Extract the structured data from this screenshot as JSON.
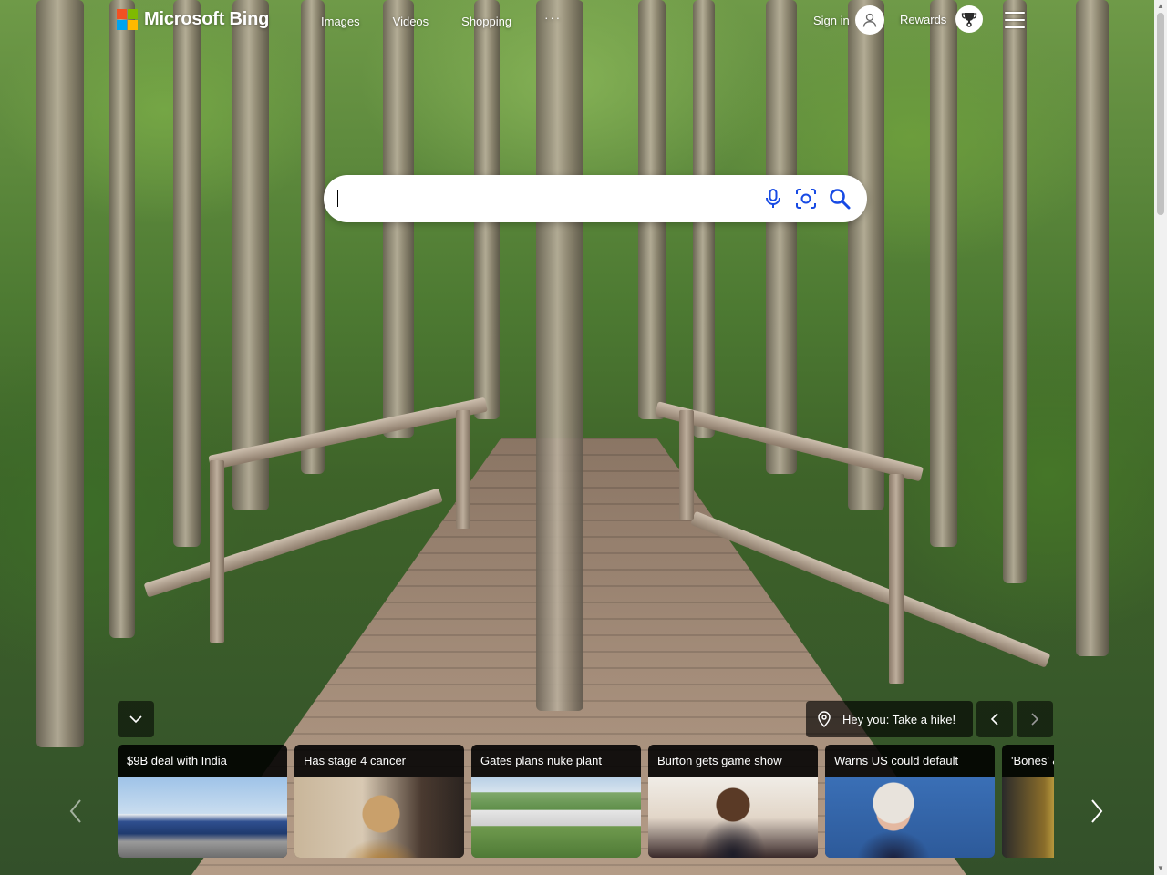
{
  "header": {
    "logo_text": "Microsoft Bing",
    "nav": [
      {
        "label": "Images"
      },
      {
        "label": "Videos"
      },
      {
        "label": "Shopping"
      }
    ],
    "more_label": "···",
    "signin_label": "Sign in",
    "rewards_label": "Rewards"
  },
  "search": {
    "value": "",
    "placeholder": ""
  },
  "background": {
    "caption": "Hey you: Take a hike!"
  },
  "news": [
    {
      "title": "$9B deal with India"
    },
    {
      "title": "Has stage 4 cancer"
    },
    {
      "title": "Gates plans nuke plant"
    },
    {
      "title": "Burton gets game show"
    },
    {
      "title": "Warns US could default"
    },
    {
      "title": "'Bones' &"
    }
  ],
  "colors": {
    "logo_red": "#f25022",
    "logo_green": "#7fba00",
    "logo_blue": "#00a4ef",
    "logo_yellow": "#ffb900",
    "search_icon": "#174ae4",
    "rewards_accent": "#2b2b2b"
  }
}
